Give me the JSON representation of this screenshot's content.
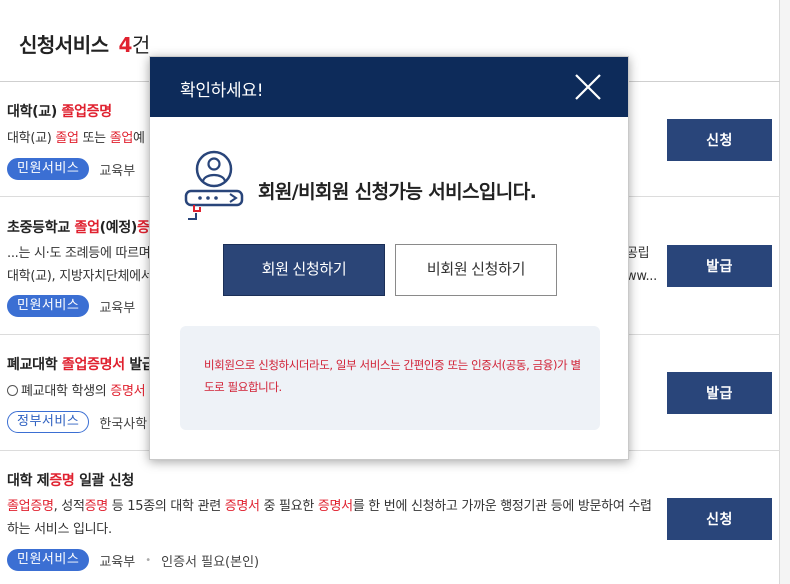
{
  "list": {
    "title": "신청서비스",
    "count": "4",
    "unit": "건"
  },
  "items": [
    {
      "name_prefix": "대학(교) ",
      "name_hl": "졸업증명",
      "desc_parts": [
        "대학(교) ",
        "졸업",
        " 또는 ",
        "졸업",
        "예"
      ],
      "tag_type": "민원서비스",
      "org": "교육부",
      "button": "신청"
    },
    {
      "name_prefix": "초중등학교 ",
      "name_hl": "졸업",
      "name_suffix": "(예정)",
      "name_hl2": "증",
      "desc_line1": "...는 시·도 조례등에 따르며",
      "desc_line1_right": "공립",
      "desc_line2": "대학(교), 지방자치단체에서",
      "desc_line2_right": "ww...",
      "tag_type": "민원서비스",
      "org": "교육부",
      "button": "발급"
    },
    {
      "name_prefix": "폐교대학 ",
      "name_hl": "졸업증명서",
      "name_suffix": " 발급",
      "desc_prefix": "폐교대학 학생의 ",
      "desc_hl": "증명서",
      "tag_type": "정부서비스",
      "org": "한국사학",
      "button": "발급"
    },
    {
      "name_prefix": "대학 제",
      "name_hl": "증명",
      "name_suffix": " 일괄 신청",
      "desc_parts": [
        "졸업증명",
        ", 성적",
        "증명",
        " 등 15종의 대학 관련 ",
        "증명서",
        " 중 필요한 ",
        "증명서",
        "를 한 번에 신청하고 가까운 행정기관 등에 방문하여 수렵하는 서비스 입니다."
      ],
      "tag_type": "민원서비스",
      "org": "교육부",
      "extra": "인증서 필요(본인)",
      "button": "신청"
    }
  ],
  "modal": {
    "title": "확인하세요!",
    "close_icon": "close-icon",
    "message": "회원/비회원 신청가능 서비스입니다.",
    "member_button": "회원 신청하기",
    "guest_button": "비회원 신청하기",
    "notice": "비회원으로 신청하시더라도, 일부 서비스는 간편인증 또는 인증서(공동, 금융)가 별도로 필요합니다."
  },
  "colors": {
    "header_navy": "#0d2b5a",
    "button_navy": "#29457a",
    "highlight_red": "#e0212f",
    "pill_blue": "#3b6fd3"
  }
}
